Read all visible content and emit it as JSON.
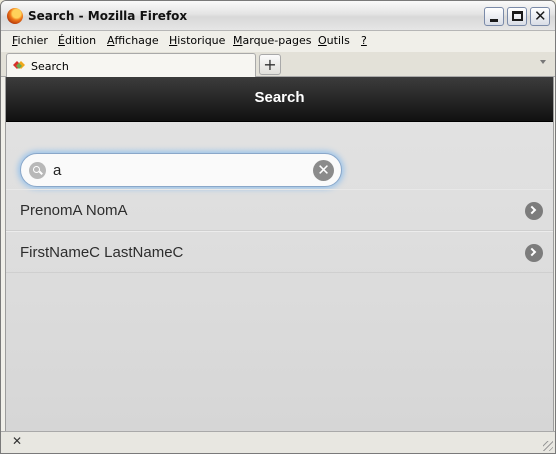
{
  "window": {
    "title": "Search - Mozilla Firefox"
  },
  "menubar": {
    "items": [
      {
        "mnemonic": "F",
        "rest": "ichier"
      },
      {
        "mnemonic": "É",
        "rest": "dition"
      },
      {
        "mnemonic": "A",
        "rest": "ffichage"
      },
      {
        "mnemonic": "H",
        "rest": "istorique"
      },
      {
        "mnemonic": "M",
        "rest": "arque-pages"
      },
      {
        "mnemonic": "O",
        "rest": "utils"
      },
      {
        "mnemonic": "?",
        "rest": ""
      }
    ]
  },
  "tabs": {
    "active_label": "Search",
    "new_tab_label": "+"
  },
  "page": {
    "header_title": "Search",
    "search": {
      "value": "a",
      "placeholder": ""
    },
    "results": [
      {
        "label": "PrenomA NomA"
      },
      {
        "label": "FirstNameC LastNameC"
      }
    ]
  },
  "statusbar": {
    "close_label": "✕"
  },
  "colors": {
    "header_bg": "#1a1a1a",
    "focus_ring": "#9ac3ea",
    "icon_grey": "#7c7c7c"
  }
}
